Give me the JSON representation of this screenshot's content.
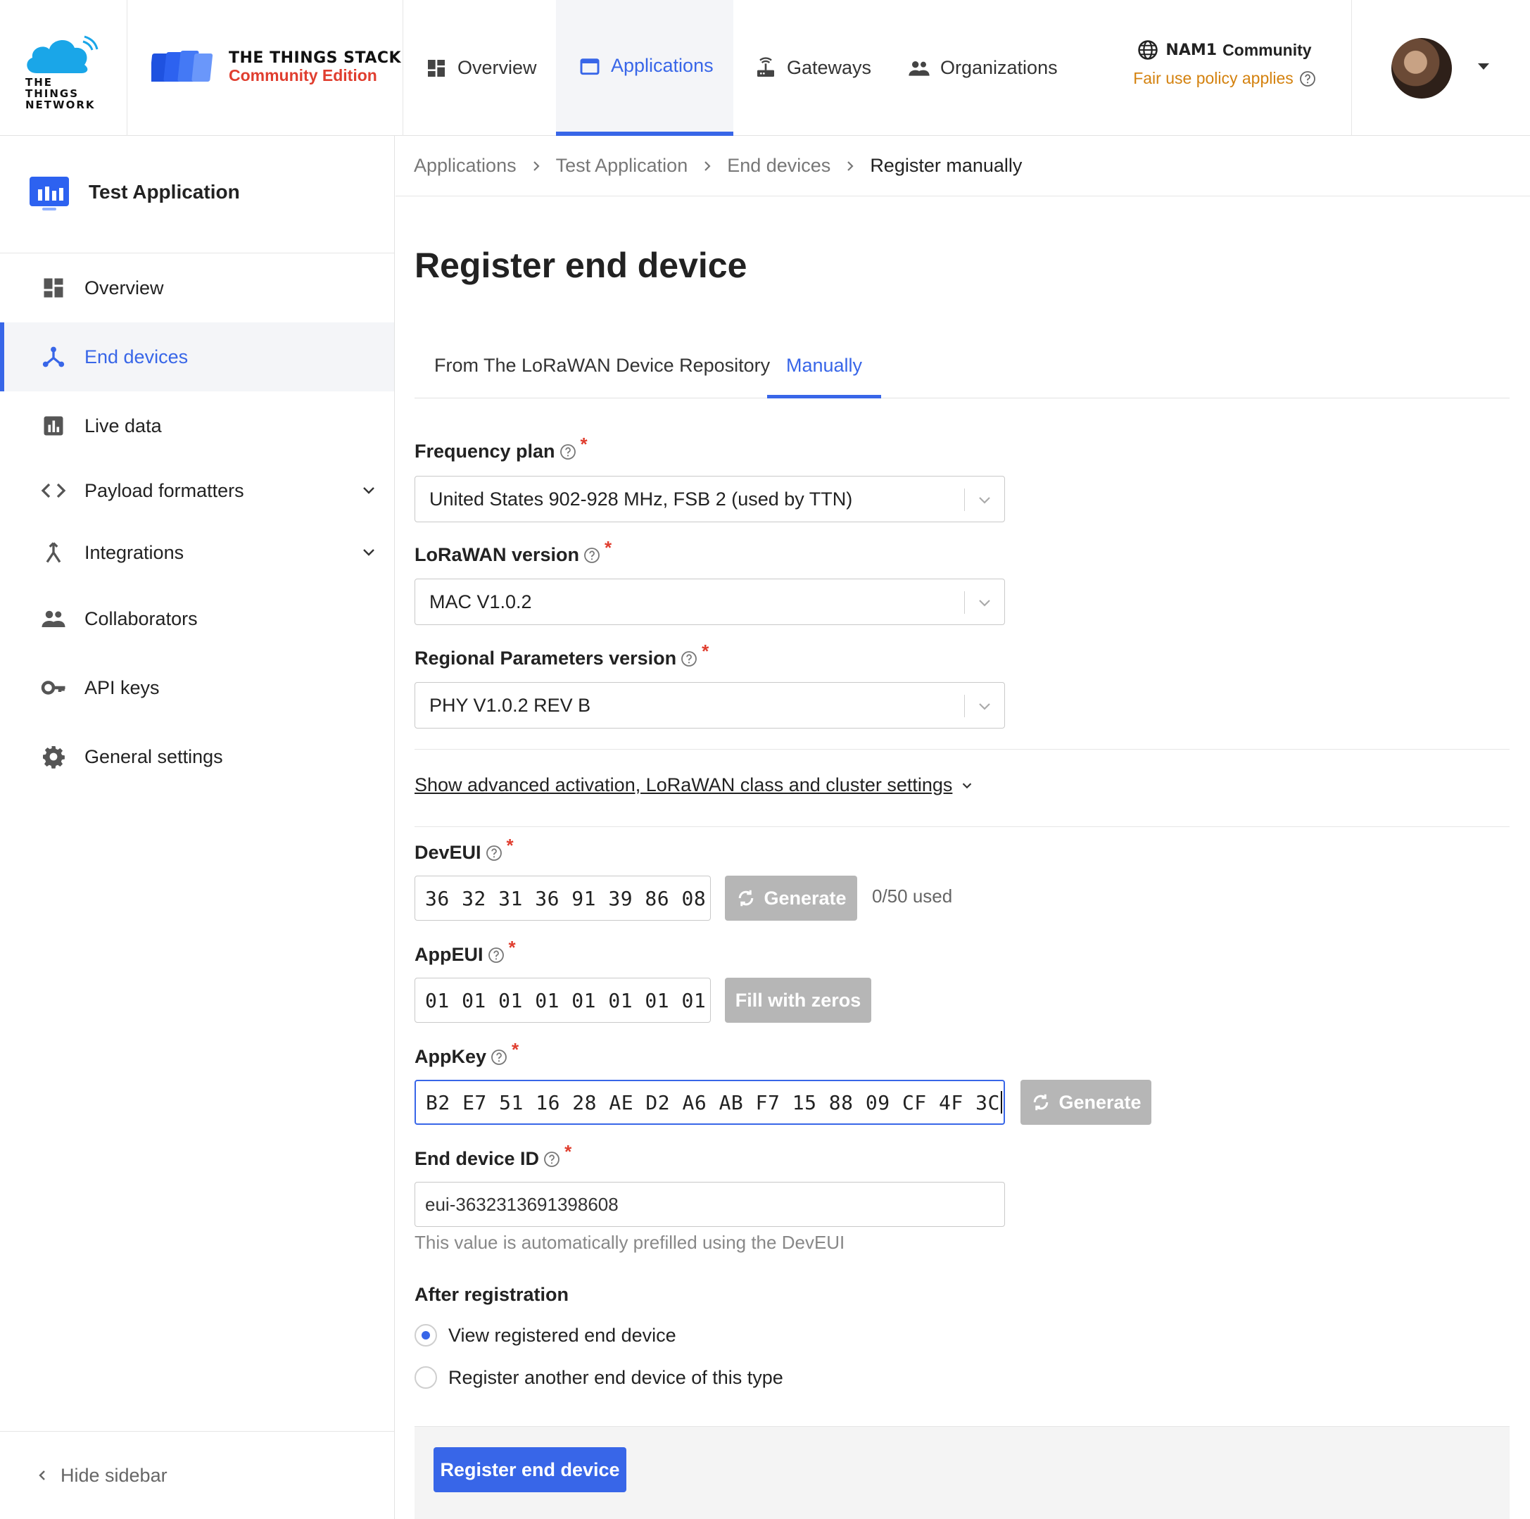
{
  "header": {
    "logo_ttn_text": "THE THINGS NETWORK",
    "logo_stack_line1": "THE THINGS STACK",
    "logo_stack_line2": "Community Edition",
    "nav": {
      "overview": "Overview",
      "applications": "Applications",
      "gateways": "Gateways",
      "organizations": "Organizations"
    },
    "active_nav": "applications",
    "cluster_id": "NAM1",
    "cluster_label": "Community",
    "fair_use": "Fair use policy applies"
  },
  "sidebar": {
    "app_title": "Test Application",
    "items": [
      {
        "label": "Overview",
        "icon": "dashboard-icon"
      },
      {
        "label": "End devices",
        "icon": "device-network-icon",
        "active": true
      },
      {
        "label": "Live data",
        "icon": "bar-chart-icon"
      },
      {
        "label": "Payload formatters",
        "icon": "code-icon",
        "expandable": true
      },
      {
        "label": "Integrations",
        "icon": "merge-icon",
        "expandable": true
      },
      {
        "label": "Collaborators",
        "icon": "people-icon"
      },
      {
        "label": "API keys",
        "icon": "key-icon"
      },
      {
        "label": "General settings",
        "icon": "gear-icon"
      }
    ],
    "hide_label": "Hide sidebar"
  },
  "breadcrumb": [
    "Applications",
    "Test Application",
    "End devices",
    "Register manually"
  ],
  "page": {
    "title": "Register end device",
    "tabs": {
      "repository": "From The LoRaWAN Device Repository",
      "manual": "Manually"
    },
    "active_tab": "manual"
  },
  "form": {
    "frequency_plan": {
      "label": "Frequency plan",
      "value": "United States 902-928 MHz, FSB 2 (used by TTN)"
    },
    "lorawan_version": {
      "label": "LoRaWAN version",
      "value": "MAC V1.0.2"
    },
    "regional_params": {
      "label": "Regional Parameters version",
      "value": "PHY V1.0.2 REV B"
    },
    "advanced_link": "Show advanced activation, LoRaWAN class and cluster settings",
    "dev_eui": {
      "label": "DevEUI",
      "value": "36 32 31 36 91 39 86 08",
      "button": "Generate",
      "usage": "0/50 used"
    },
    "app_eui": {
      "label": "AppEUI",
      "value": "01 01 01 01 01 01 01 01",
      "button": "Fill with zeros"
    },
    "app_key": {
      "label": "AppKey",
      "value": "B2 E7 51 16 28 AE D2 A6 AB F7 15 88 09 CF 4F 3C",
      "button": "Generate"
    },
    "end_device_id": {
      "label": "End device ID",
      "value": "eui-3632313691398608",
      "hint": "This value is automatically prefilled using the DevEUI"
    },
    "after_registration": {
      "title": "After registration",
      "options": [
        "View registered end device",
        "Register another end device of this type"
      ],
      "selected": 0
    },
    "submit": "Register end device"
  },
  "colors": {
    "accent": "#3866e8",
    "required": "#e03e2f",
    "fair_use": "#d4820f",
    "disabled_button": "#b6b6b6"
  }
}
